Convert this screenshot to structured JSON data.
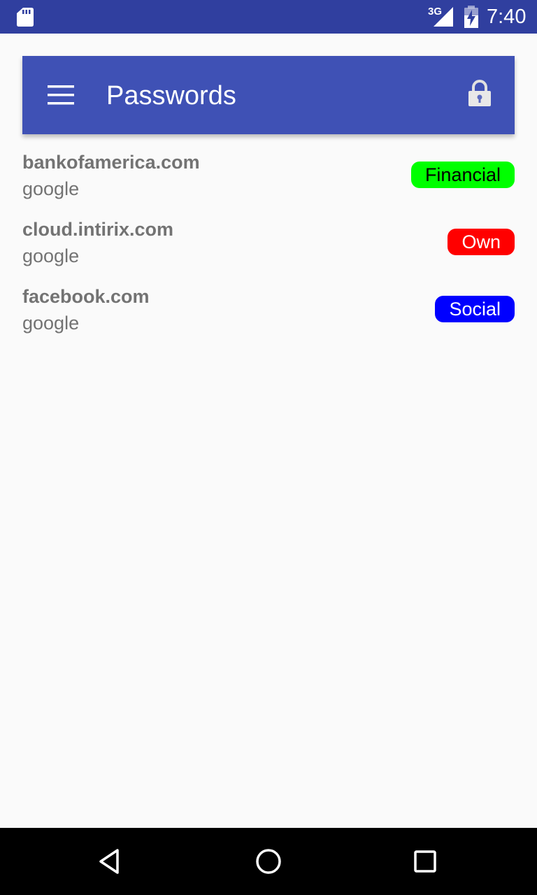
{
  "status_bar": {
    "network": "3G",
    "time": "7:40",
    "icons": [
      "sd-card-icon",
      "signal-icon",
      "battery-charging-icon"
    ]
  },
  "app_bar": {
    "title": "Passwords",
    "menu_icon": "hamburger-menu-icon",
    "action_icon": "lock-icon",
    "color": "#3f51b5"
  },
  "items": [
    {
      "domain": "bankofamerica.com",
      "user": "google",
      "tag": "Financial",
      "tag_bg": "#00ff00",
      "tag_fg": "#000000"
    },
    {
      "domain": "cloud.intirix.com",
      "user": "google",
      "tag": "Own",
      "tag_bg": "#ff0000",
      "tag_fg": "#ffffff"
    },
    {
      "domain": "facebook.com",
      "user": "google",
      "tag": "Social",
      "tag_bg": "#0000ff",
      "tag_fg": "#ffffff"
    }
  ],
  "nav_bar": {
    "icons": [
      "back-icon",
      "home-icon",
      "recents-icon"
    ]
  }
}
